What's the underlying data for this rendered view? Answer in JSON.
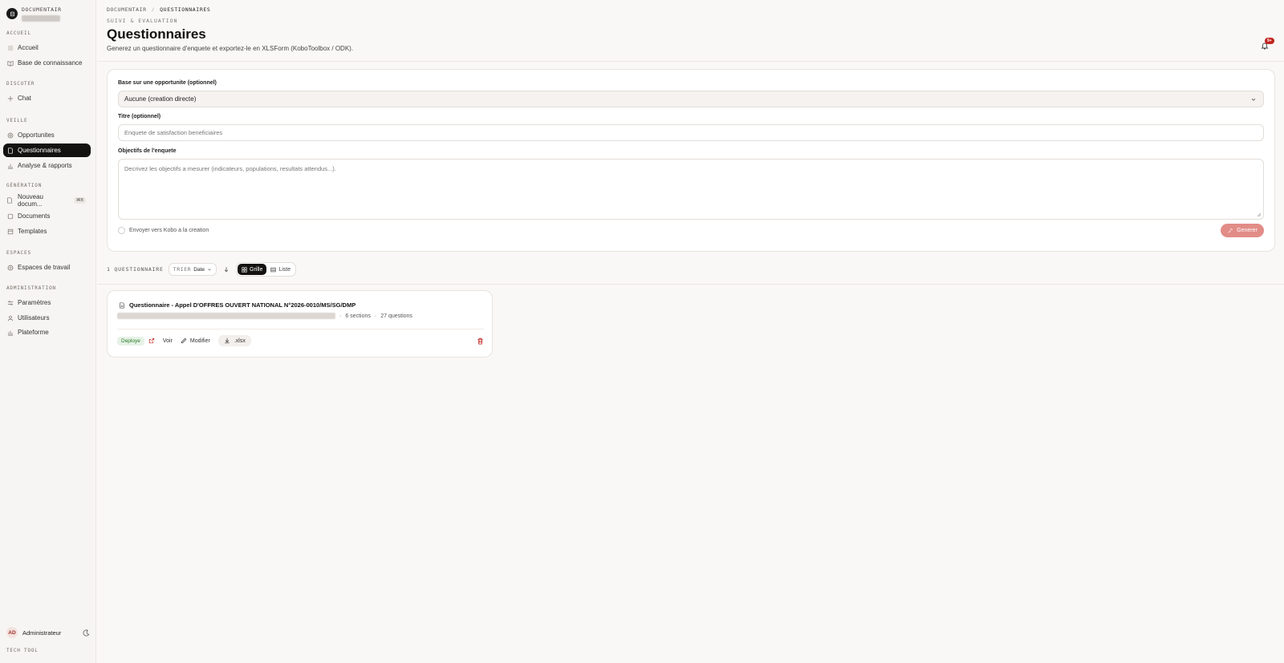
{
  "app": {
    "name": "DOCUMENTAIR"
  },
  "sidebar": {
    "sections": {
      "accueil": "ACCUEIL",
      "discuter": "DISCUTER",
      "veille": "VEILLE",
      "generation": "GÉNÉRATION",
      "espaces": "ESPACES",
      "administration": "ADMINISTRATION"
    },
    "items": {
      "accueil": "Accueil",
      "base": "Base de connaissance",
      "chat": "Chat",
      "opportunites": "Opportunites",
      "questionnaires": "Questionnaires",
      "analyse": "Analyse & rapports",
      "nouveau": "Nouveau docum...",
      "nouveau_badge": "⌘B",
      "documents": "Documents",
      "templates": "Templates",
      "espaces_travail": "Espaces de travail",
      "parametres": "Paramètres",
      "utilisateurs": "Utilisateurs",
      "plateforme": "Plateforme"
    },
    "user": {
      "initials": "AD",
      "name": "Administrateur"
    },
    "footer": "TECH TOOL"
  },
  "header": {
    "breadcrumb": [
      "DOCUMENTAIR",
      "/",
      "QUESTIONNAIRES"
    ],
    "eyebrow": "SUIVI & EVALUATION",
    "title": "Questionnaires",
    "subtitle": "Generez un questionnaire d'enquete et exportez-le en XLSForm (KoboToolbox / ODK).",
    "notif_count": "9+"
  },
  "form": {
    "opportunity_label": "Base sur une opportunite (optionnel)",
    "opportunity_value": "Aucune (creation directe)",
    "title_label": "Titre (optionnel)",
    "title_placeholder": "Enquete de satisfaction beneficiaires",
    "objectives_label": "Objectifs de l'enquete",
    "objectives_placeholder": "Decrivez les objectifs a mesurer (indicateurs, populations, resultats attendus...).",
    "kobo_label": "Envoyer vers Kobo a la creation",
    "submit_label": "Generer"
  },
  "toolbar": {
    "count": "1 QUESTIONNAIRE",
    "sort_label": "TRIER",
    "sort_value": "Date",
    "view_grid": "Grille",
    "view_list": "Liste"
  },
  "questionnaires": [
    {
      "title": "Questionnaire - Appel D'OFFRES OUVERT NATIONAL N°2026-0010/MS/SG/DMP",
      "sections": "6 sections",
      "questions": "27 questions",
      "status": "Deploye",
      "view": "Voir",
      "edit": "Modifier",
      "export": ".xlsx"
    }
  ],
  "colors": {
    "accent": "#141210",
    "danger": "#c0241e",
    "generate": "#e28c87"
  }
}
